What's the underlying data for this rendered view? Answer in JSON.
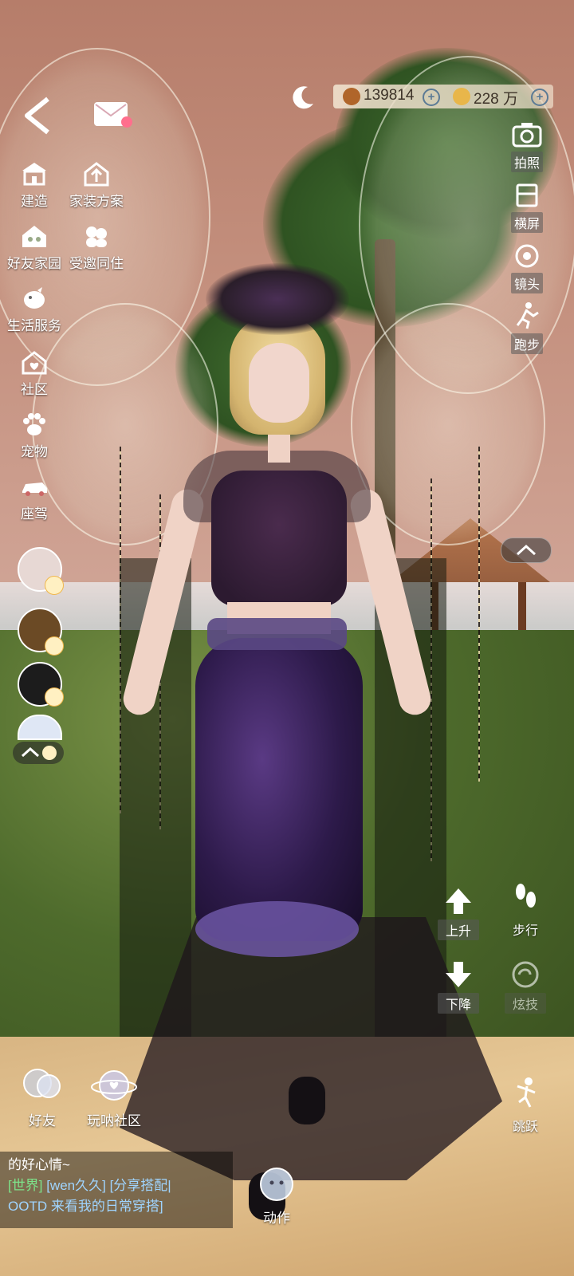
{
  "top_bar": {
    "currency_a": "139814",
    "currency_b": "228 万",
    "plus_symbol": "+"
  },
  "left_menu": [
    {
      "label": "建造",
      "icon": "building-icon"
    },
    {
      "label": "家装方案",
      "icon": "house-upload-icon"
    },
    {
      "label": "好友家园",
      "icon": "friends-home-icon"
    },
    {
      "label": "受邀同住",
      "icon": "cohabit-icon"
    },
    {
      "label": "生活服务",
      "icon": "bird-service-icon"
    },
    {
      "label": "社区",
      "icon": "community-icon"
    },
    {
      "label": "宠物",
      "icon": "paw-icon"
    },
    {
      "label": "座驾",
      "icon": "car-icon"
    }
  ],
  "right_menu": [
    {
      "label": "拍照",
      "icon": "camera-icon"
    },
    {
      "label": "横屏",
      "icon": "rotate-screen-icon"
    },
    {
      "label": "镜头",
      "icon": "lens-icon"
    },
    {
      "label": "跑步",
      "icon": "running-icon"
    }
  ],
  "movement": {
    "up": "上升",
    "down": "下降",
    "walk": "步行",
    "skill": "炫技",
    "jump": "跳跃"
  },
  "bottom": {
    "friends": "好友",
    "community": "玩呐社区",
    "action": "动作"
  },
  "chat": {
    "line1": "的好心情~",
    "channel": "[世界]",
    "user": "[wen久久]",
    "msg_a": "[分享搭配|",
    "msg_b": "OOTD 来看我的日常穿搭]"
  },
  "colors": {
    "chat_channel": "#7de38a",
    "chat_link": "#9fd4ff",
    "currency_bg": "#f0e1cd"
  }
}
